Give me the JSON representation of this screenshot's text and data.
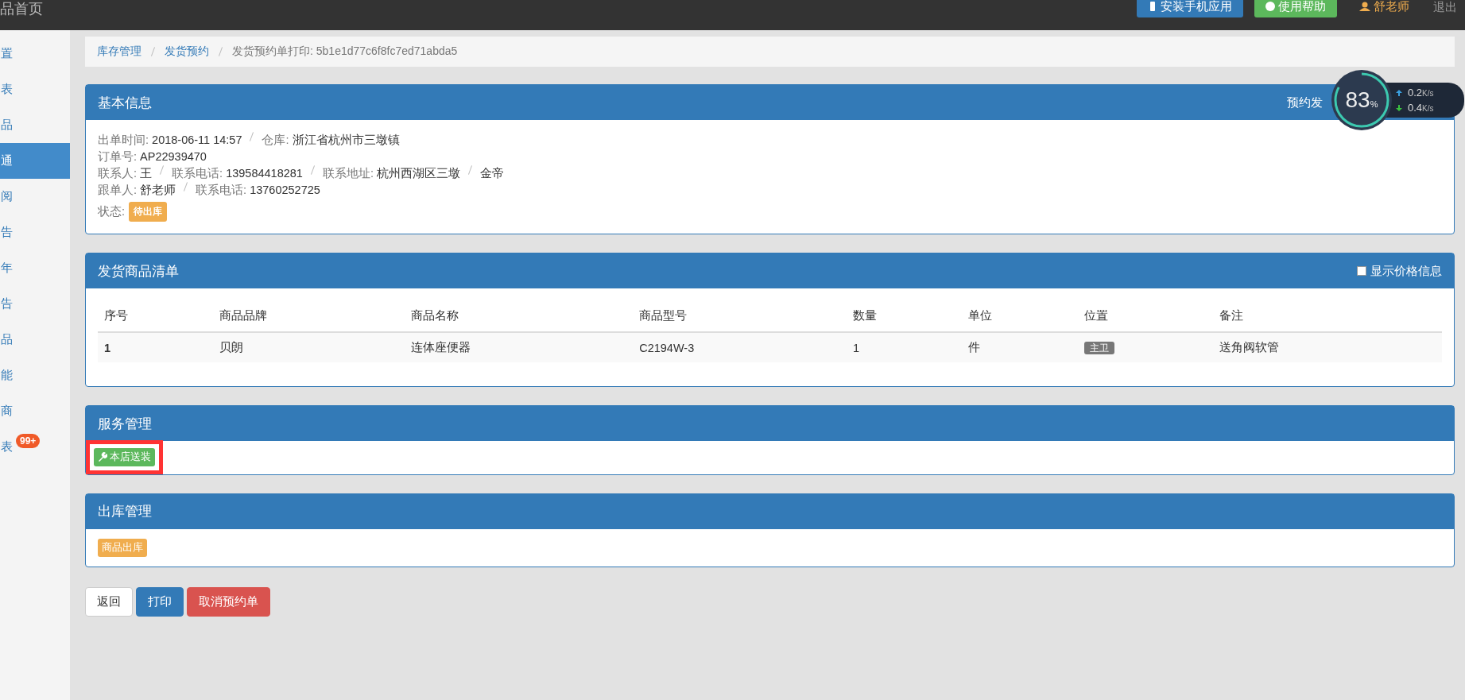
{
  "topbar": {
    "brand": "品首页",
    "buttons": [
      {
        "label": "安装手机应用",
        "kind": "primary"
      },
      {
        "label": "使用帮助",
        "kind": "success"
      }
    ],
    "user": "舒老师",
    "logout": "退出"
  },
  "sidebar": {
    "items": [
      {
        "label": "置",
        "selected": false
      },
      {
        "label": "表",
        "selected": false
      },
      {
        "label": "品",
        "selected": false
      },
      {
        "label": "通",
        "selected": true
      },
      {
        "label": "阅",
        "selected": false
      },
      {
        "label": "告",
        "selected": false
      },
      {
        "label": "年",
        "selected": false
      },
      {
        "label": "告",
        "selected": false
      },
      {
        "label": "品",
        "selected": false
      },
      {
        "label": "能",
        "selected": false
      },
      {
        "label": "商",
        "selected": false
      },
      {
        "label": "表",
        "selected": false,
        "badge": "99+"
      }
    ]
  },
  "breadcrumb": [
    {
      "label": "库存管理",
      "link": true
    },
    {
      "label": "发货预约",
      "link": true
    },
    {
      "label": "发货预约单打印: 5b1e1d77c6f8fc7ed71abda5",
      "link": false
    }
  ],
  "basic_info": {
    "title": "基本信息",
    "header_right": "预约发",
    "lines": [
      [
        {
          "label": "出单时间:",
          "value": "2018-06-11 14:57"
        },
        {
          "label": "仓库:",
          "value": "浙江省杭州市三墩镇"
        }
      ],
      [
        {
          "label": "订单号:",
          "value": "AP22939470"
        }
      ],
      [
        {
          "label": "联系人:",
          "value": "王"
        },
        {
          "label": "联系电话:",
          "value": "139584418281"
        },
        {
          "label": "联系地址:",
          "value": "杭州西湖区三墩"
        },
        {
          "value": "金帝"
        }
      ],
      [
        {
          "label": "跟单人:",
          "value": "舒老师"
        },
        {
          "label": "联系电话:",
          "value": "13760252725"
        }
      ]
    ],
    "status_label": "状态:",
    "status": "待出库"
  },
  "speed_widget": {
    "percent": "83",
    "unit": "%",
    "up": "0.2",
    "up_unit": "K/s",
    "down": "0.4",
    "down_unit": "K/s"
  },
  "goods": {
    "title": "发货商品清单",
    "show_price": {
      "label": "显示价格信息",
      "checked": false
    },
    "columns": [
      "序号",
      "商品品牌",
      "商品名称",
      "商品型号",
      "数量",
      "单位",
      "位置",
      "备注"
    ],
    "rows": [
      [
        "1",
        "贝朗",
        "连体座便器",
        "C2194W-3",
        "1",
        "件",
        "主卫",
        "送角阀软管"
      ]
    ]
  },
  "service": {
    "title": "服务管理",
    "buttons": [
      {
        "label": "本店送装",
        "highlighted": true
      }
    ]
  },
  "outbound": {
    "title": "出库管理",
    "buttons": [
      {
        "label": "商品出库"
      }
    ]
  },
  "actions": [
    {
      "label": "返回",
      "kind": "default"
    },
    {
      "label": "打印",
      "kind": "primary"
    },
    {
      "label": "取消预约单",
      "kind": "danger"
    }
  ]
}
